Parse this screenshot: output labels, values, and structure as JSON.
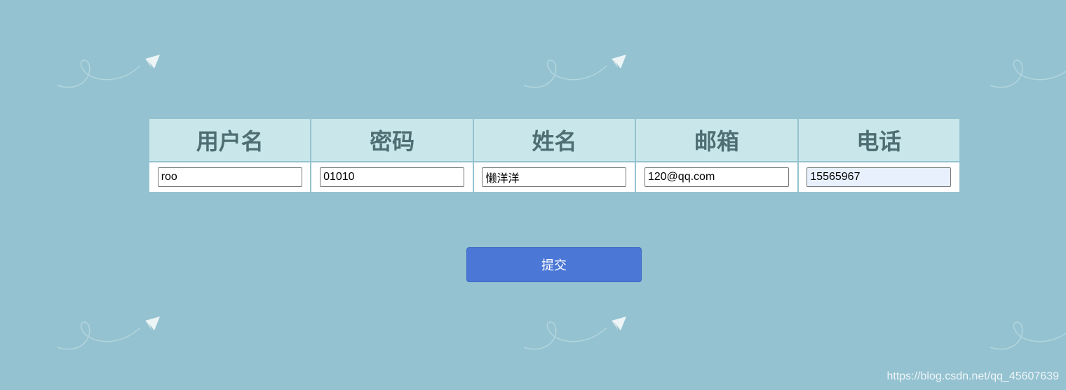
{
  "table": {
    "headers": [
      "用户名",
      "密码",
      "姓名",
      "邮箱",
      "电话"
    ],
    "values": [
      "roo",
      "01010",
      "懒洋洋",
      "120@qq.com",
      "15565967"
    ]
  },
  "submit_label": "提交",
  "watermark": "https://blog.csdn.net/qq_45607639",
  "colors": {
    "background": "#94c2d0",
    "header_bg": "#c9e7ea",
    "header_text": "#4e6e74",
    "button_bg": "#4b78d6",
    "autofill_bg": "#e8f0fe"
  },
  "icons": [
    "paper-plane-icon"
  ]
}
